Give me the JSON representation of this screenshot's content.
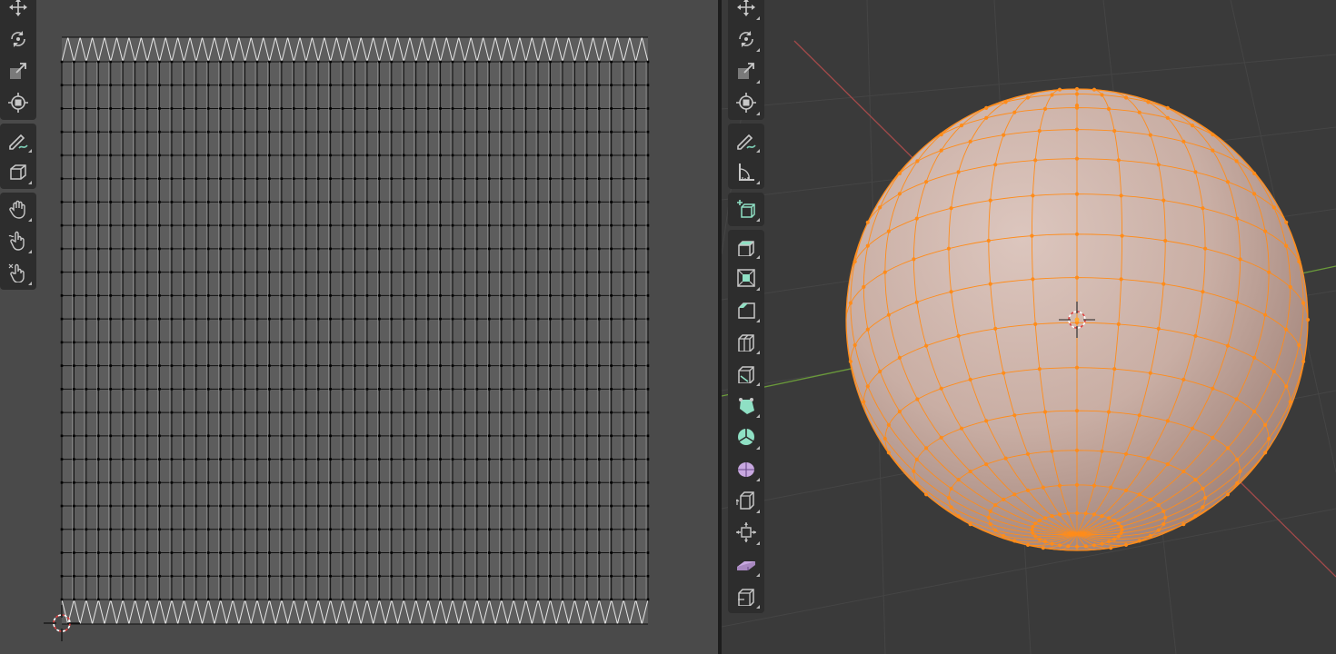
{
  "uv_editor": {
    "toolbar_groups": [
      [
        "move-icon",
        "rotate-icon",
        "scale-icon",
        "transform-icon"
      ],
      [
        "annotate-icon",
        "cursor-cube-icon"
      ],
      [
        "grab-hand-icon",
        "relax-hand-icon",
        "pinch-hand-icon"
      ]
    ]
  },
  "viewport": {
    "toolbar_groups": [
      [
        "move-icon",
        "rotate-icon",
        "scale-icon",
        "transform-icon"
      ],
      [
        "annotate-icon",
        "measure-icon"
      ],
      [
        "add-cube-icon"
      ],
      [
        "extrude-icon",
        "inset-icon",
        "bevel-icon",
        "loop-cut-icon",
        "knife-icon",
        "poly-build-icon",
        "spin-icon",
        "smooth-icon",
        "edge-slide-icon",
        "shrink-fatten-icon",
        "shear-icon",
        "rip-region-icon"
      ]
    ]
  },
  "colors": {
    "uv_background": "#4a4a4a",
    "viewport_background": "#3a3a3a",
    "uv_face_fill": "#5d5d5d",
    "selected_vertex": "#ff8c1a",
    "sphere_fill": "#c9aea4",
    "x_axis": "#a34a4a",
    "y_axis": "#6a9a3a"
  }
}
